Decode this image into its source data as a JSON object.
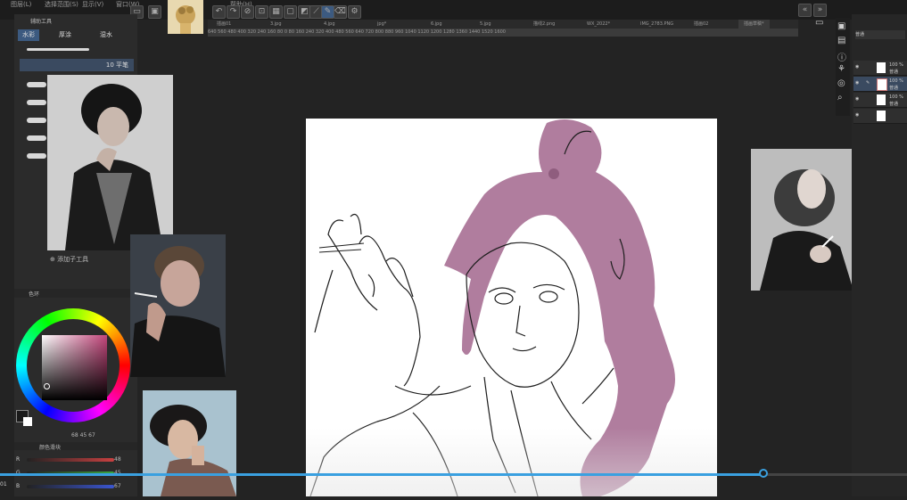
{
  "menu": {
    "items": [
      "图层(L)",
      "选择范围(S)",
      "显示(V)",
      "窗口(W)"
    ],
    "help": "帮助(H)"
  },
  "toolbar": {
    "icons": [
      "undo-icon",
      "redo-icon",
      "clear-icon",
      "transform-icon",
      "deselect-icon",
      "crop-icon",
      "fill-icon",
      "line-icon",
      "pen-icon",
      "eraser-icon",
      "settings-icon"
    ]
  },
  "document_tabs": [
    "插画01",
    "3.jpg",
    "4.jpg",
    "jpg*",
    "6.jpg",
    "5.jpg",
    "描线2.png",
    "WX_2022*",
    "IMG_2783.PNG",
    "插画02",
    "插画草稿*"
  ],
  "ruler_ticks": [
    "640",
    "560",
    "480",
    "400",
    "320",
    "240",
    "160",
    "80",
    "0",
    "80",
    "160",
    "240",
    "320",
    "400",
    "480",
    "560",
    "640",
    "720",
    "800",
    "880",
    "960",
    "1040",
    "1120",
    "1200",
    "1280",
    "1360",
    "1440",
    "1520",
    "1600"
  ],
  "left_panel": {
    "header": "辅助工具",
    "tabs": [
      "水彩",
      "厚涂",
      "湿水"
    ],
    "brush_label": "10 平笔",
    "add_subtool": "添加子工具",
    "color_panel_label": "色环",
    "color_values": {
      "h": "68",
      "s": "45",
      "v": "67"
    },
    "slider_panel_label": "颜色滑块",
    "sliders": [
      {
        "label": "R",
        "value": "48",
        "color": "#c94040"
      },
      {
        "label": "G",
        "value": "45",
        "color": "#3aa640"
      },
      {
        "label": "B",
        "value": "67",
        "color": "#3a55d0"
      }
    ]
  },
  "right_panel": {
    "layers": [
      {
        "opacity": "100 %",
        "mode": "普通",
        "selected": false
      },
      {
        "opacity": "100 %",
        "mode": "普通",
        "selected": true
      },
      {
        "opacity": "100 %",
        "mode": "普通",
        "selected": false
      },
      {
        "opacity": "",
        "mode": "",
        "selected": false
      }
    ],
    "blend_label": "普通"
  },
  "colors": {
    "hair": "#b07d9e",
    "accent": "#3aa0e0",
    "panel": "#2b2b2b",
    "canvas": "#ffffff"
  },
  "video": {
    "time": "01",
    "progress": 0.843
  }
}
